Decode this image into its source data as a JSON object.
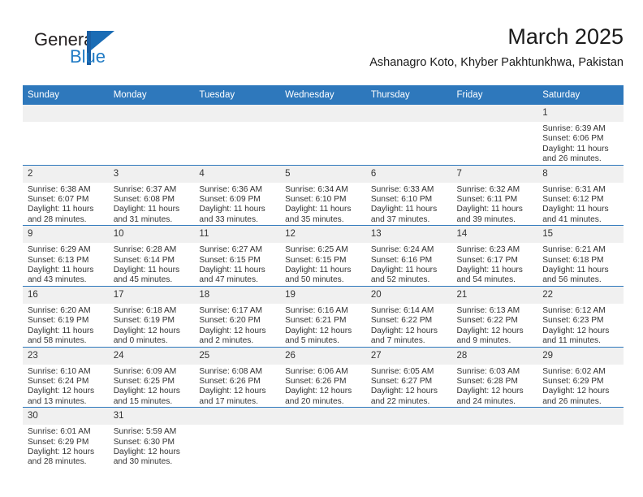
{
  "brand": {
    "name_top": "General",
    "name_bottom": "Blue",
    "logo_icon": "flag-triangle-icon",
    "accent_color": "#1f7ac4"
  },
  "header": {
    "month_title": "March 2025",
    "location": "Ashanagro Koto, Khyber Pakhtunkhwa, Pakistan"
  },
  "theme": {
    "header_blue": "#2e78bc",
    "day_band_gray": "#f0f0f0",
    "text_color": "#333333"
  },
  "calendar": {
    "weekday_headers": [
      "Sunday",
      "Monday",
      "Tuesday",
      "Wednesday",
      "Thursday",
      "Friday",
      "Saturday"
    ],
    "weeks": [
      [
        {
          "day": "",
          "blank": true,
          "lines": [
            "",
            "",
            "",
            ""
          ]
        },
        {
          "day": "",
          "blank": true,
          "lines": [
            "",
            "",
            "",
            ""
          ]
        },
        {
          "day": "",
          "blank": true,
          "lines": [
            "",
            "",
            "",
            ""
          ]
        },
        {
          "day": "",
          "blank": true,
          "lines": [
            "",
            "",
            "",
            ""
          ]
        },
        {
          "day": "",
          "blank": true,
          "lines": [
            "",
            "",
            "",
            ""
          ]
        },
        {
          "day": "",
          "blank": true,
          "lines": [
            "",
            "",
            "",
            ""
          ]
        },
        {
          "day": "1",
          "blank": false,
          "lines": [
            "Sunrise: 6:39 AM",
            "Sunset: 6:06 PM",
            "Daylight: 11 hours",
            "and 26 minutes."
          ]
        }
      ],
      [
        {
          "day": "2",
          "blank": false,
          "lines": [
            "Sunrise: 6:38 AM",
            "Sunset: 6:07 PM",
            "Daylight: 11 hours",
            "and 28 minutes."
          ]
        },
        {
          "day": "3",
          "blank": false,
          "lines": [
            "Sunrise: 6:37 AM",
            "Sunset: 6:08 PM",
            "Daylight: 11 hours",
            "and 31 minutes."
          ]
        },
        {
          "day": "4",
          "blank": false,
          "lines": [
            "Sunrise: 6:36 AM",
            "Sunset: 6:09 PM",
            "Daylight: 11 hours",
            "and 33 minutes."
          ]
        },
        {
          "day": "5",
          "blank": false,
          "lines": [
            "Sunrise: 6:34 AM",
            "Sunset: 6:10 PM",
            "Daylight: 11 hours",
            "and 35 minutes."
          ]
        },
        {
          "day": "6",
          "blank": false,
          "lines": [
            "Sunrise: 6:33 AM",
            "Sunset: 6:10 PM",
            "Daylight: 11 hours",
            "and 37 minutes."
          ]
        },
        {
          "day": "7",
          "blank": false,
          "lines": [
            "Sunrise: 6:32 AM",
            "Sunset: 6:11 PM",
            "Daylight: 11 hours",
            "and 39 minutes."
          ]
        },
        {
          "day": "8",
          "blank": false,
          "lines": [
            "Sunrise: 6:31 AM",
            "Sunset: 6:12 PM",
            "Daylight: 11 hours",
            "and 41 minutes."
          ]
        }
      ],
      [
        {
          "day": "9",
          "blank": false,
          "lines": [
            "Sunrise: 6:29 AM",
            "Sunset: 6:13 PM",
            "Daylight: 11 hours",
            "and 43 minutes."
          ]
        },
        {
          "day": "10",
          "blank": false,
          "lines": [
            "Sunrise: 6:28 AM",
            "Sunset: 6:14 PM",
            "Daylight: 11 hours",
            "and 45 minutes."
          ]
        },
        {
          "day": "11",
          "blank": false,
          "lines": [
            "Sunrise: 6:27 AM",
            "Sunset: 6:15 PM",
            "Daylight: 11 hours",
            "and 47 minutes."
          ]
        },
        {
          "day": "12",
          "blank": false,
          "lines": [
            "Sunrise: 6:25 AM",
            "Sunset: 6:15 PM",
            "Daylight: 11 hours",
            "and 50 minutes."
          ]
        },
        {
          "day": "13",
          "blank": false,
          "lines": [
            "Sunrise: 6:24 AM",
            "Sunset: 6:16 PM",
            "Daylight: 11 hours",
            "and 52 minutes."
          ]
        },
        {
          "day": "14",
          "blank": false,
          "lines": [
            "Sunrise: 6:23 AM",
            "Sunset: 6:17 PM",
            "Daylight: 11 hours",
            "and 54 minutes."
          ]
        },
        {
          "day": "15",
          "blank": false,
          "lines": [
            "Sunrise: 6:21 AM",
            "Sunset: 6:18 PM",
            "Daylight: 11 hours",
            "and 56 minutes."
          ]
        }
      ],
      [
        {
          "day": "16",
          "blank": false,
          "lines": [
            "Sunrise: 6:20 AM",
            "Sunset: 6:19 PM",
            "Daylight: 11 hours",
            "and 58 minutes."
          ]
        },
        {
          "day": "17",
          "blank": false,
          "lines": [
            "Sunrise: 6:18 AM",
            "Sunset: 6:19 PM",
            "Daylight: 12 hours",
            "and 0 minutes."
          ]
        },
        {
          "day": "18",
          "blank": false,
          "lines": [
            "Sunrise: 6:17 AM",
            "Sunset: 6:20 PM",
            "Daylight: 12 hours",
            "and 2 minutes."
          ]
        },
        {
          "day": "19",
          "blank": false,
          "lines": [
            "Sunrise: 6:16 AM",
            "Sunset: 6:21 PM",
            "Daylight: 12 hours",
            "and 5 minutes."
          ]
        },
        {
          "day": "20",
          "blank": false,
          "lines": [
            "Sunrise: 6:14 AM",
            "Sunset: 6:22 PM",
            "Daylight: 12 hours",
            "and 7 minutes."
          ]
        },
        {
          "day": "21",
          "blank": false,
          "lines": [
            "Sunrise: 6:13 AM",
            "Sunset: 6:22 PM",
            "Daylight: 12 hours",
            "and 9 minutes."
          ]
        },
        {
          "day": "22",
          "blank": false,
          "lines": [
            "Sunrise: 6:12 AM",
            "Sunset: 6:23 PM",
            "Daylight: 12 hours",
            "and 11 minutes."
          ]
        }
      ],
      [
        {
          "day": "23",
          "blank": false,
          "lines": [
            "Sunrise: 6:10 AM",
            "Sunset: 6:24 PM",
            "Daylight: 12 hours",
            "and 13 minutes."
          ]
        },
        {
          "day": "24",
          "blank": false,
          "lines": [
            "Sunrise: 6:09 AM",
            "Sunset: 6:25 PM",
            "Daylight: 12 hours",
            "and 15 minutes."
          ]
        },
        {
          "day": "25",
          "blank": false,
          "lines": [
            "Sunrise: 6:08 AM",
            "Sunset: 6:26 PM",
            "Daylight: 12 hours",
            "and 17 minutes."
          ]
        },
        {
          "day": "26",
          "blank": false,
          "lines": [
            "Sunrise: 6:06 AM",
            "Sunset: 6:26 PM",
            "Daylight: 12 hours",
            "and 20 minutes."
          ]
        },
        {
          "day": "27",
          "blank": false,
          "lines": [
            "Sunrise: 6:05 AM",
            "Sunset: 6:27 PM",
            "Daylight: 12 hours",
            "and 22 minutes."
          ]
        },
        {
          "day": "28",
          "blank": false,
          "lines": [
            "Sunrise: 6:03 AM",
            "Sunset: 6:28 PM",
            "Daylight: 12 hours",
            "and 24 minutes."
          ]
        },
        {
          "day": "29",
          "blank": false,
          "lines": [
            "Sunrise: 6:02 AM",
            "Sunset: 6:29 PM",
            "Daylight: 12 hours",
            "and 26 minutes."
          ]
        }
      ],
      [
        {
          "day": "30",
          "blank": false,
          "lines": [
            "Sunrise: 6:01 AM",
            "Sunset: 6:29 PM",
            "Daylight: 12 hours",
            "and 28 minutes."
          ]
        },
        {
          "day": "31",
          "blank": false,
          "lines": [
            "Sunrise: 5:59 AM",
            "Sunset: 6:30 PM",
            "Daylight: 12 hours",
            "and 30 minutes."
          ]
        },
        {
          "day": "",
          "blank": true,
          "lines": [
            "",
            "",
            "",
            ""
          ]
        },
        {
          "day": "",
          "blank": true,
          "lines": [
            "",
            "",
            "",
            ""
          ]
        },
        {
          "day": "",
          "blank": true,
          "lines": [
            "",
            "",
            "",
            ""
          ]
        },
        {
          "day": "",
          "blank": true,
          "lines": [
            "",
            "",
            "",
            ""
          ]
        },
        {
          "day": "",
          "blank": true,
          "lines": [
            "",
            "",
            "",
            ""
          ]
        }
      ]
    ]
  }
}
